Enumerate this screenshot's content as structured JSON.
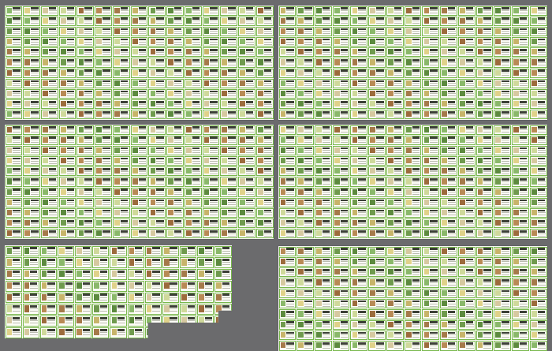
{
  "canvas": {
    "background": "#6b6b6d",
    "sheet_background": "#f7f7f2",
    "card_border": "#79b84d"
  },
  "sheets": [
    {
      "name": "sheet-top-left",
      "cols": 15,
      "rows": 11
    },
    {
      "name": "sheet-top-right",
      "cols": 15,
      "rows": 11
    },
    {
      "name": "sheet-middle-left",
      "cols": 15,
      "rows": 11
    },
    {
      "name": "sheet-middle-right",
      "cols": 15,
      "rows": 11
    },
    {
      "name": "sheet-bottom-left",
      "cols": 13,
      "rows": 8
    },
    {
      "name": "sheet-bottom-right",
      "cols": 15,
      "rows": 10
    }
  ],
  "thumb_colors": [
    "#8ab86a",
    "#c7b46a",
    "#9c6b3c",
    "#e0d28a",
    "#6f9a4d",
    "#b88a55",
    "#d6c9a0",
    "#5c8a3e",
    "#a57a4a",
    "#cfd99b"
  ]
}
